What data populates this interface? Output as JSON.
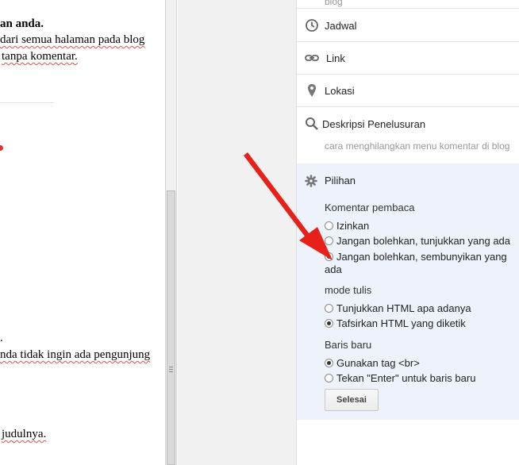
{
  "editor": {
    "lines": [
      "an anda.",
      "dari semua halaman pada blog",
      "tanpa komentar.",
      ".",
      "nda tidak ingin ada pengunjung",
      "judulnya."
    ]
  },
  "panel": {
    "top_fragment": "blog",
    "items": {
      "jadwal": "Jadwal",
      "link": "Link",
      "lokasi": "Lokasi",
      "deskripsi": "Deskripsi Penelusuran"
    },
    "deskripsi_value": "cara menghilangkan menu komentar di blog",
    "pilihan": {
      "title": "Pilihan",
      "komentar_label": "Komentar pembaca",
      "komentar_options": [
        "Izinkan",
        "Jangan bolehkan, tunjukkan yang ada",
        "Jangan bolehkan, sembunyikan yang ada"
      ],
      "komentar_selected": 2,
      "mode_label": "mode tulis",
      "mode_options": [
        "Tunjukkan HTML apa adanya",
        "Tafsirkan HTML yang diketik"
      ],
      "mode_selected": 1,
      "baris_label": "Baris baru",
      "baris_options": [
        "Gunakan tag <br>",
        "Tekan \"Enter\" untuk baris baru"
      ],
      "baris_selected": 0,
      "done_label": "Selesai"
    }
  },
  "colors": {
    "arrow": "#e8201a",
    "pilihan_bg": "#eef3fb"
  }
}
